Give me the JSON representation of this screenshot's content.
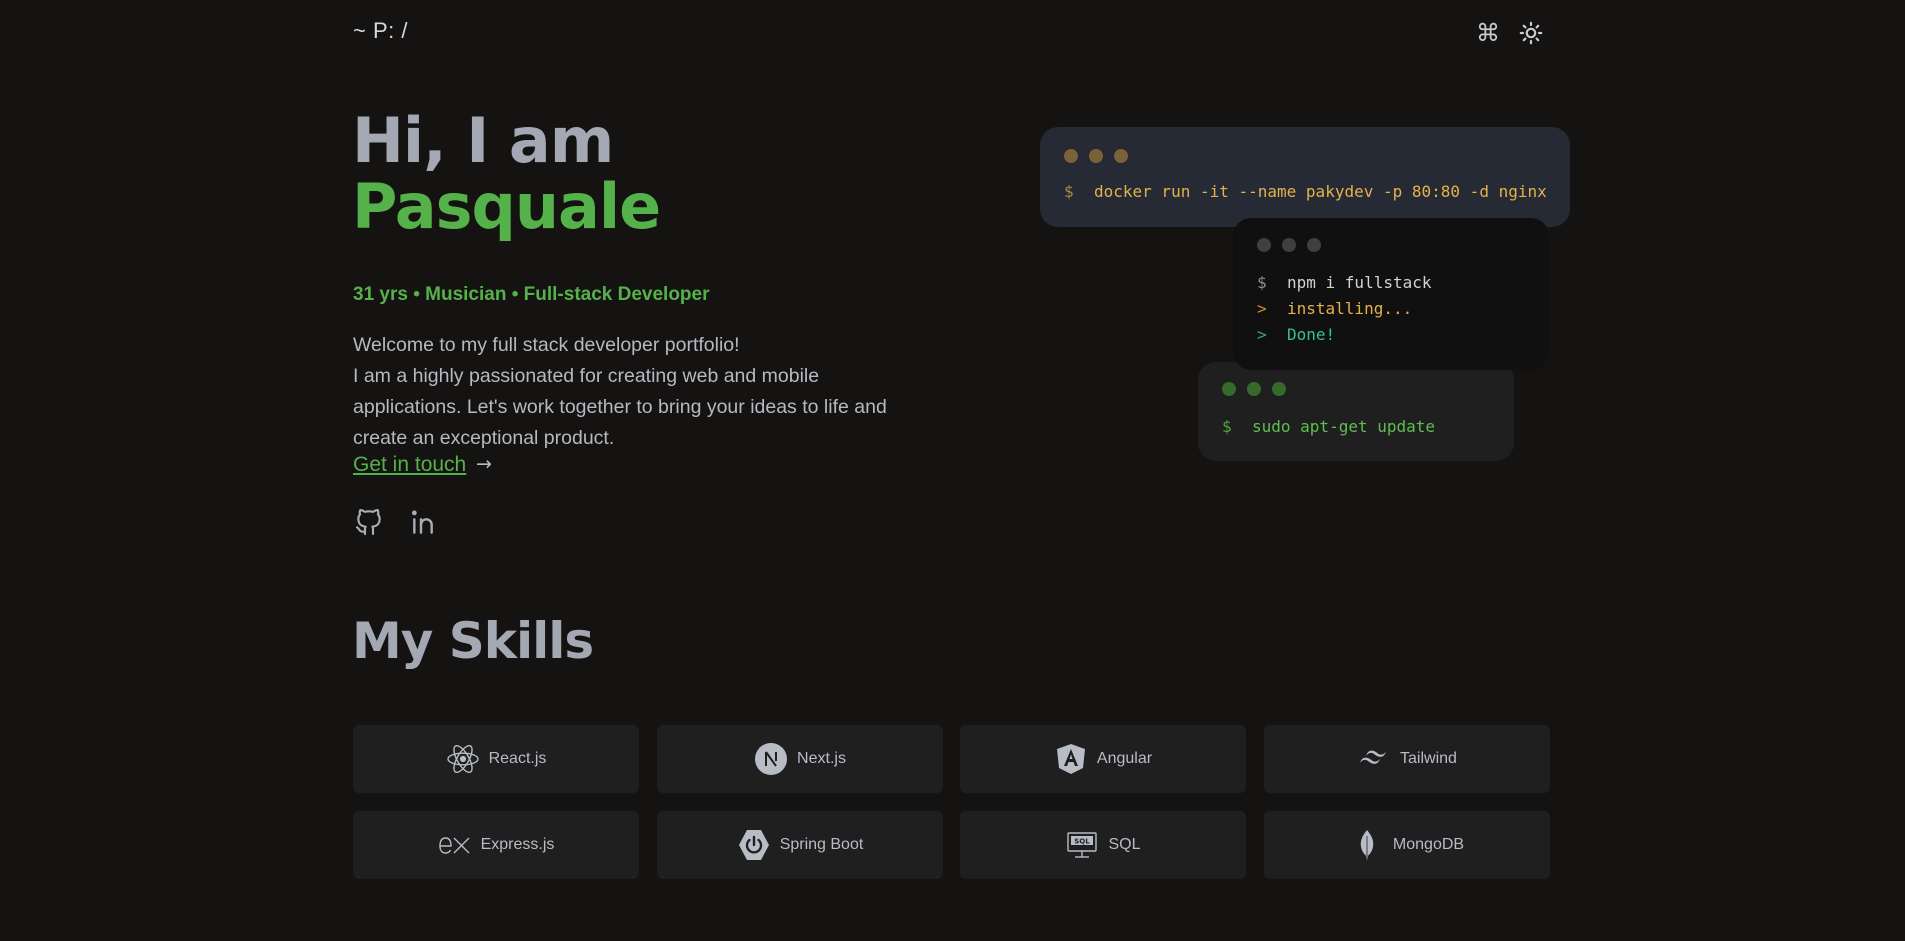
{
  "header": {
    "brand": "~ P: /",
    "command_icon": "command-icon",
    "theme_icon": "sun-icon"
  },
  "hero": {
    "greeting": "Hi, I am",
    "name": "Pasquale",
    "tagline": "31 yrs • Musician • Full-stack Developer",
    "intro_lines": [
      "Welcome to my full stack developer portfolio!",
      "I am a highly passionated for creating web and mobile applications. Let's work together to bring your ideas to life and create an exceptional product."
    ],
    "cta_label": "Get in touch",
    "cta_arrow": "→",
    "social": [
      "github-icon",
      "linkedin-icon"
    ]
  },
  "terminals": {
    "docker": {
      "prompt": "$",
      "command": "docker run -it --name pakydev -p 80:80 -d nginx"
    },
    "npm": {
      "prompt": "$",
      "command": "npm i fullstack",
      "out1_marker": ">",
      "out1": "installing...",
      "out2_marker": ">",
      "out2": "Done!"
    },
    "apt": {
      "prompt": "$",
      "command": "sudo apt-get update"
    }
  },
  "skills": {
    "title": "My Skills",
    "items": [
      {
        "label": "React.js",
        "icon": "react-icon"
      },
      {
        "label": "Next.js",
        "icon": "nextjs-icon"
      },
      {
        "label": "Angular",
        "icon": "angular-icon"
      },
      {
        "label": "Tailwind",
        "icon": "tailwind-icon"
      },
      {
        "label": "Express.js",
        "icon": "express-icon"
      },
      {
        "label": "Spring Boot",
        "icon": "spring-boot-icon"
      },
      {
        "label": "SQL",
        "icon": "sql-icon"
      },
      {
        "label": "MongoDB",
        "icon": "mongodb-icon"
      }
    ]
  },
  "colors": {
    "background": "#151212",
    "accent_green": "#55b24a",
    "heading_gray": "#a3a8b3",
    "card": "#1f1f20"
  }
}
